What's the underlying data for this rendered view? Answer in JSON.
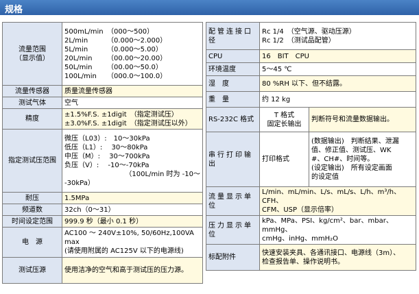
{
  "header": {
    "title": "规格"
  },
  "left_table": {
    "flow_range": {
      "label_1": "流量范围",
      "label_2": "（显示值）",
      "rows": [
        {
          "range": "500mL/min",
          "display": "（000～500）"
        },
        {
          "range": "2L/min",
          "display": "（0.000～2.000）"
        },
        {
          "range": "5L/min",
          "display": "（0.000～5.00）"
        },
        {
          "range": "20L/min",
          "display": "（00.00～20.00）"
        },
        {
          "range": "50L/min",
          "display": "（00.00～50.0）"
        },
        {
          "range": "100L/min",
          "display": "（000.0～100.0）"
        }
      ]
    },
    "sensor": {
      "label": "流量传感器",
      "value": "质量流量传感器"
    },
    "gas": {
      "label": "测试气体",
      "value": "空气"
    },
    "accuracy": {
      "label": "精度",
      "line1": "±1.5%F.S. ±1digit　（指定测试压）",
      "line2": "±3.0%F.S. ±1digit　（指定测试压以外）"
    },
    "pressure_range": {
      "label": "指定测试压范围",
      "line1": "微压（L03）:　10～30kPa",
      "line2": "低压（L1）:　 30～80kPa",
      "line3": "中压（M）:　 30～700kPa",
      "line4": "负压（V）:　 -10～-70kPa",
      "line5": "（100L/min 时为 -10～",
      "line6": "-30kPa）"
    },
    "proof": {
      "label": "耐压",
      "value": "1.5MPa"
    },
    "channels": {
      "label": "频道数",
      "value": "32ch（0～31）"
    },
    "time": {
      "label": "时间设定范围",
      "value": "999.9 秒（最小 0.1 秒）"
    },
    "power": {
      "label": "电　源",
      "line1": "AC100 ～ 240V±10%,  50/60Hz,100VA",
      "line2": "max",
      "line3": "(请使用附属的 AC125V 以下的电源线)"
    },
    "source": {
      "label": "测试压源",
      "value": "使用洁净的空气和高于测试压的压力源。"
    }
  },
  "right_table": {
    "piping": {
      "label": "配管连接口径",
      "line1": "Rc 1/4　（空气源、驱动压源）",
      "line2": "Rc 1/2　（测试品配管）"
    },
    "cpu": {
      "label": "CPU",
      "value": "16　BIT　CPU"
    },
    "temp": {
      "label": "环境温度",
      "value": "5～45 ℃"
    },
    "humidity": {
      "label": "湿　度",
      "value": "80 %RH 以下、但不结露。"
    },
    "weight": {
      "label": "重　量",
      "value": "约 12 kg"
    },
    "rs232c": {
      "label": "RS-232C 格式",
      "sub_1": "T 格式",
      "sub_2": "固定长输出",
      "value": "判断符号和流量数据输出。"
    },
    "serial": {
      "label": "串行打印输出",
      "sub": "打印格式",
      "line1": "(数据输出)　判断结果、泄漏",
      "line2": "值、修正值、测试压、WK",
      "line3": "#、CH#、时间等。",
      "line4": "(设定输出)　所有设定画面",
      "line5": "的设定值"
    },
    "flow_units": {
      "label": "流量显示单位",
      "line1": "L/min、mL/min、L/s、mL/s、L/h、m³/h、CFH、",
      "line2": "CFM、USP（显示倍率）"
    },
    "pressure_units": {
      "label": "压力显示单位",
      "line1": "kPa、MPa、PSI、kg/cm²、bar、mbar、mmHg、",
      "line2": "cmHg、inHg、mmH₂O"
    },
    "accessories": {
      "label": "标配附件",
      "line1": "快速安装夹具、各通讯接口、电源线（3m）、",
      "line2": "检查报告单、操作说明书。"
    }
  }
}
